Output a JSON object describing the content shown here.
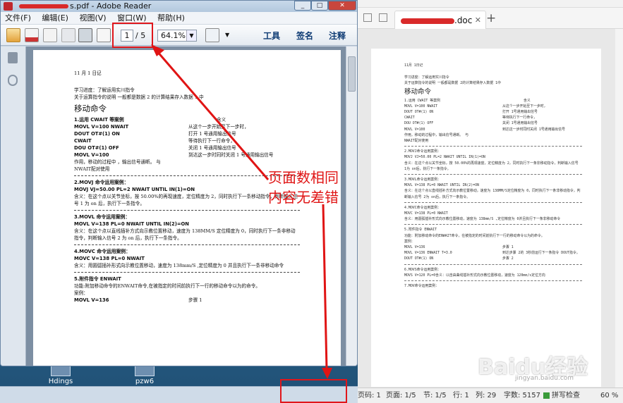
{
  "desktop": {
    "icons": [
      {
        "label": "Hdings"
      },
      {
        "label": "pzw6"
      }
    ]
  },
  "reader": {
    "title": "s.pdf - Adobe Reader",
    "menu": [
      "文件(F)",
      "编辑(E)",
      "视图(V)",
      "窗口(W)",
      "帮助(H)"
    ],
    "page_current": "1",
    "page_total": "/ 5",
    "zoom": "64.1%",
    "links": {
      "tools": "工具",
      "sign": "签名",
      "comment": "注释"
    },
    "doc": {
      "date": "11 月 1 日记",
      "intro1": "学习进度：了解运用实川指令",
      "intro2": "关于运算指令的说明 一般都是数据 2 的计算结果存入数据 1 中",
      "heading": "移动命令",
      "s1_title": "1.运用 CWAIT 等案例",
      "s1_col": "含义",
      "s1_rows": [
        [
          "MOVL V=100 NWAIT",
          "从这个一步开始至下一步时，"
        ],
        [
          "DOUT OT#(1) ON",
          "打开 1 号通用输出信号"
        ],
        [
          "CWAIT",
          "等待执行下一行命令，"
        ],
        [
          "DOU OT#(1) OFF",
          "关闭 1 号通用输出信号"
        ],
        [
          "MOVL V=100",
          "到达这一步时同时关闭 1 号通用输出信号"
        ]
      ],
      "s1_note1": "作用，移动的过程中 ，输出信号通断。 与",
      "s1_note2": "NWAIT配对使用",
      "s2_title": "2.MOVJ 命令运用案例：",
      "s2_code": "MOVJ   VJ=50.00   PL=2    NWAIT    UNTIL    IN(1)=ON",
      "s2_desc": "含义：在这个点以关节坐标，按 50.00%的再现速度，定位精度为 2，同时执行下一条移动指令，判断输入信号 1 为 on 后，执行下一条指令。",
      "s3_title": "3.MOVL 命令运用案例：",
      "s3_code": "MOVL    V=138    PL=0      NWAIT     UNTIL      IN(2)=ON",
      "s3_desc": "含义：在这个点以直线插补方式向示教位置移动，速度为 138MM/S 定位精度为 0，同时执行下一条非移动指令，判断输入信号 2 为 on 后，执行下一条指令。",
      "s4_title": "4.MOVC 命令运用案例：",
      "s4_code": "MOVC      V=138     PL=0       NWAIT",
      "s4_desc": "含义：用圆弧插补形式向示教位置移动，速度为 138mm/S ,定位精度为 0 并且执行下一条非移动命令",
      "s5_title": "5.附件指令 ENWAIT",
      "s5_desc": "功能:附加移动命令的ENWAIT命令,在被指定的时间前执行下一行的移动命令以为的命令。",
      "s5_ex": "案例：",
      "s5_row": [
        "MOVL    V=136",
        "步骤 1"
      ]
    }
  },
  "wps": {
    "tab_suffix": ".doc",
    "doc": {
      "date": "11月    1日记",
      "intro1": "学习进度：了解运用实川指令",
      "intro2": "关于运算指令的说明 一般都是数据  2的计算结果存入数据   1中",
      "heading": "移动命令",
      "s1_title": "1.运用  CWAIT 等案例",
      "s1_col": "含义",
      "s1_rows": [
        [
          "MOVL V=100 NWAIT",
          "从这个一步开始至下一步时，"
        ],
        [
          "DOUT OT#(1) ON",
          "打开  1号通用输出信号"
        ],
        [
          "CWAIT",
          "等待执行下一行命令，"
        ],
        [
          "DOU OT#(1) OFF",
          "关闭  1号通用输出信号"
        ],
        [
          "MOVL V=100",
          "到达这一步时同时关闭  1号通用输出信号"
        ]
      ],
      "s1_note1": "作用，移动的过程中，输出信号通断。   与",
      "s1_note2": "NWAIT配对使用",
      "s2_title": "2.MOVJ命令运用案例：",
      "s2_code": "MOVJ  VJ=50.00   PL=2   NWAIT   UNTIL  IN(1)=ON",
      "s2_desc": "含义：在这个点以关节坐标，按 50.00%的再现速度，定位精度为  2，同时执行下一条非移动指令，判断输入信号  1为  on后，执行下一条指令。",
      "s3_title": "3.MOVL命令运用案例：",
      "s3_code": "MOVL   V=138    PL=0     NWAIT     UNTIL     IN(2)=ON",
      "s3_desc": "含义：在这个点以直线插补方式向示教位置移动，速度为  138MM/S定位精度为  0，同时执行下一条非移动指令，判断输入信号  2为  on后，执行下一条指令。",
      "s4_title": "4.MOVC命令运用案例：",
      "s4_code": "MOVC      V=138     PL=0      NWAIT",
      "s4_desc": "含义：用圆弧插补形式向示教位置移动，速度为  138mm/S ,定位精度为 0并且执行下一条非移动命令",
      "s5_title": "5.附件指令    ENWAIT",
      "s5_desc": "功能：附加移动命令的ENWAIT命令，在被指定的时间前执行下一行的移动命令以为的命令。",
      "s5_ex": "案例：",
      "s5_rows": [
        [
          "MOVL V=136",
          "步骤  1"
        ],
        [
          "MOVL V=136 ENWAIT T=3.0",
          "到达步骤  2的  3秒前运行下一条指令    DOUT指令。"
        ],
        [
          "DOUT OT#(1)    ON",
          "步骤  2"
        ]
      ],
      "s6_title": "6.MOVS命令运用案例：",
      "s6_desc": "MOVS V=120 PL=0含义：以自由曲线插补形式向示教位置移动，速度为    120mm/s定位方向",
      "s7_title": "7.MOV命令运用案例："
    },
    "status": {
      "page_label": "页码: 1",
      "pages": "页面: 1/5",
      "section": "节: 1/5",
      "line": "行: 1",
      "col": "列: 29",
      "words": "字数: 5157",
      "spell": "拼写检查",
      "zoom": "60 %"
    }
  },
  "annotation": {
    "line1": "页面数相同",
    "line2": "内容无差错"
  },
  "watermark": {
    "text": "Baidu经验",
    "url": "jingyan.baidu.com"
  },
  "colors": {
    "annotation_red": "#e01414",
    "reader_link": "#0d3a73",
    "pdf_red": "#c0282d"
  }
}
